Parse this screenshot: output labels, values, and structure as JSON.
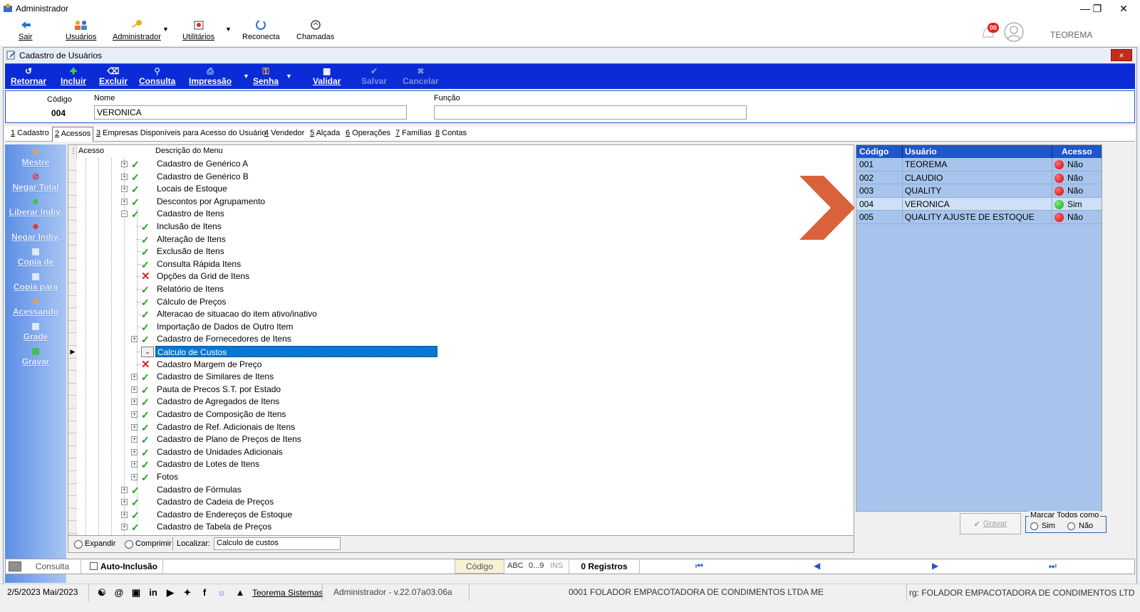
{
  "window": {
    "title": "Administrador",
    "right_label": "TEOREMA",
    "notification_count": "00"
  },
  "toolbar": [
    {
      "label": "Sair",
      "icon": "exit-icon"
    },
    {
      "label": "Usuários",
      "icon": "users-icon"
    },
    {
      "label": "Administrador",
      "icon": "key-icon"
    },
    {
      "label": "Utilitários",
      "icon": "utilities-icon"
    },
    {
      "label": "Reconecta",
      "icon": "reconnect-icon"
    },
    {
      "label": "Chamadas",
      "icon": "calls-icon"
    }
  ],
  "inner_window": {
    "title": "Cadastro de Usuários",
    "close": "×"
  },
  "bluebar": [
    {
      "label": "Retornar"
    },
    {
      "label": "Incluir"
    },
    {
      "label": "Excluir"
    },
    {
      "label": "Consulta"
    },
    {
      "label": "Impressão"
    },
    {
      "label": "Senha"
    },
    {
      "label": "Validar"
    },
    {
      "label": "Salvar"
    },
    {
      "label": "Cancelar"
    }
  ],
  "header": {
    "codigo_label": "Código",
    "codigo_value": "004",
    "nome_label": "Nome",
    "nome_value": "VERONICA",
    "funcao_label": "Função",
    "funcao_value": ""
  },
  "tabs": [
    {
      "num": "1",
      "label": " Cadastro"
    },
    {
      "num": "2",
      "label": " Acessos"
    },
    {
      "num": "3",
      "label": " Empresas Disponíveis para Acesso do Usuário"
    },
    {
      "num": "4",
      "label": " Vendedor"
    },
    {
      "num": "5",
      "label": " Alçada"
    },
    {
      "num": "6",
      "label": " Operações"
    },
    {
      "num": "7",
      "label": " Famílias"
    },
    {
      "num": "8",
      "label": " Contas"
    }
  ],
  "sidebar": [
    {
      "label": "Mestre"
    },
    {
      "label": "Negar Total"
    },
    {
      "label": "Liberar Indiv."
    },
    {
      "label": "Negar Indiv."
    },
    {
      "label": "Copia de"
    },
    {
      "label": "Copia para"
    },
    {
      "label": "Acessando"
    },
    {
      "label": "Grade"
    },
    {
      "label": "Gravar"
    }
  ],
  "tree": {
    "col_acesso": "Acesso",
    "col_descricao": "Descrição do Menu",
    "rows": [
      {
        "text": "Cadastro de Genérico A",
        "level": 1,
        "access": "yes",
        "expander": "+"
      },
      {
        "text": "Cadastro de Genérico B",
        "level": 1,
        "access": "yes",
        "expander": "+"
      },
      {
        "text": "Locais de Estoque",
        "level": 1,
        "access": "yes",
        "expander": "+"
      },
      {
        "text": "Descontos por Agrupamento",
        "level": 1,
        "access": "yes",
        "expander": "+"
      },
      {
        "text": "Cadastro de Itens",
        "level": 1,
        "access": "yes",
        "expander": "-"
      },
      {
        "text": "Inclusão de Itens",
        "level": 2,
        "access": "yes",
        "expander": ""
      },
      {
        "text": "Alteração de Itens",
        "level": 2,
        "access": "yes",
        "expander": ""
      },
      {
        "text": "Exclusão de Itens",
        "level": 2,
        "access": "yes",
        "expander": ""
      },
      {
        "text": "Consulta Rápida Itens",
        "level": 2,
        "access": "yes",
        "expander": ""
      },
      {
        "text": "Opções da Grid de Itens",
        "level": 2,
        "access": "no",
        "expander": ""
      },
      {
        "text": "Relatório de Itens",
        "level": 2,
        "access": "yes",
        "expander": ""
      },
      {
        "text": "Cálculo de Preços",
        "level": 2,
        "access": "yes",
        "expander": ""
      },
      {
        "text": "Alteracao de situacao do item ativo/inativo",
        "level": 2,
        "access": "yes",
        "expander": ""
      },
      {
        "text": "Importação de Dados de Outro Item",
        "level": 2,
        "access": "yes",
        "expander": ""
      },
      {
        "text": "Cadastro de Fornecedores de Itens",
        "level": 2,
        "access": "yes",
        "expander": "+"
      },
      {
        "text": "Calculo de Custos",
        "level": 2,
        "access": "dropdown",
        "expander": "",
        "selected": true
      },
      {
        "text": "Cadastro Margem de Preço",
        "level": 2,
        "access": "no",
        "expander": ""
      },
      {
        "text": "Cadastro de Similares de Itens",
        "level": 2,
        "access": "yes",
        "expander": "+"
      },
      {
        "text": "Pauta de Precos S.T. por Estado",
        "level": 2,
        "access": "yes",
        "expander": "+"
      },
      {
        "text": "Cadastro de Agregados de Itens",
        "level": 2,
        "access": "yes",
        "expander": "+"
      },
      {
        "text": "Cadastro de Composição de Itens",
        "level": 2,
        "access": "yes",
        "expander": "+"
      },
      {
        "text": "Cadastro de Ref. Adicionais de Itens",
        "level": 2,
        "access": "yes",
        "expander": "+"
      },
      {
        "text": "Cadastro de Plano de Preços de Itens",
        "level": 2,
        "access": "yes",
        "expander": "+"
      },
      {
        "text": "Cadastro de Unidades Adicionais",
        "level": 2,
        "access": "yes",
        "expander": "+"
      },
      {
        "text": "Cadastro de Lotes de Itens",
        "level": 2,
        "access": "yes",
        "expander": "+"
      },
      {
        "text": "Fotos",
        "level": 2,
        "access": "yes",
        "expander": "+"
      },
      {
        "text": "Cadastro de Fórmulas",
        "level": 1,
        "access": "yes",
        "expander": "+"
      },
      {
        "text": "Cadastro de Cadeia de Preços",
        "level": 1,
        "access": "yes",
        "expander": "+"
      },
      {
        "text": "Cadastro de Endereços de Estoque",
        "level": 1,
        "access": "yes",
        "expander": "+"
      },
      {
        "text": "Cadastro de Tabela de Preços",
        "level": 1,
        "access": "yes",
        "expander": "+"
      }
    ],
    "expandir": "Expandir",
    "comprimir": "Comprimir",
    "localizar_label": "Localizar:",
    "localizar_value": "Calculo de custos"
  },
  "users_panel": {
    "col_codigo": "Código",
    "col_usuario": "Usuário",
    "col_acesso": "Acesso",
    "rows": [
      {
        "codigo": "001",
        "usuario": "TEOREMA",
        "acesso": "Não",
        "status": "red"
      },
      {
        "codigo": "002",
        "usuario": "CLAUDIO",
        "acesso": "Não",
        "status": "red"
      },
      {
        "codigo": "003",
        "usuario": "QUALITY",
        "acesso": "Não",
        "status": "red"
      },
      {
        "codigo": "004",
        "usuario": "VERONICA",
        "acesso": "Sim",
        "status": "green"
      },
      {
        "codigo": "005",
        "usuario": "QUALITY AJUSTE DE ESTOQUE",
        "acesso": "Não",
        "status": "red"
      }
    ],
    "gravar": "Gravar",
    "marcar_todos": "Marcar Todos como",
    "sim": "Sim",
    "nao": "Não"
  },
  "statusbar": {
    "consulta": "Consulta",
    "auto_inclusao": "Auto-Inclusão",
    "codigo": "Código",
    "abc": "ABC",
    "num": "0...9",
    "ins": "INS",
    "registros": "0 Registros"
  },
  "bottombar": {
    "date": "2/5/2023 Mai/2023",
    "brand": "Teorema Sistemas",
    "version": "Administrador - v.22.07a03.06a",
    "company": "0001 FOLADOR EMPACOTADORA DE CONDIMENTOS LTDA ME",
    "company_right": "rg: FOLADOR EMPACOTADORA DE CONDIMENTOS LTD"
  },
  "colors": {
    "blue_toolbar": "#0a2bd6",
    "selection": "#0078d7",
    "panel": "#a7c5ec",
    "arrow": "#d9623b"
  }
}
